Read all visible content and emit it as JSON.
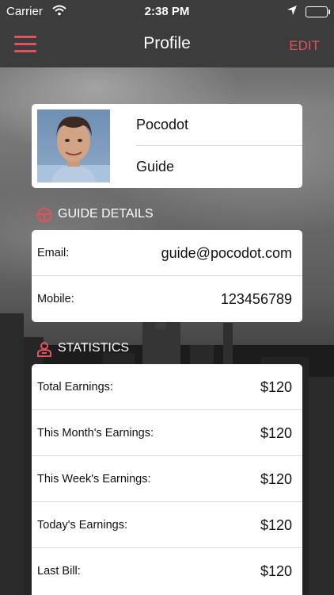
{
  "status_bar": {
    "carrier": "Carrier",
    "time": "2:38 PM",
    "battery_level": 1.0
  },
  "nav": {
    "title": "Profile",
    "edit_label": "EDIT"
  },
  "profile": {
    "name": "Pocodot",
    "role": "Guide"
  },
  "guide_details": {
    "title": "GUIDE DETAILS",
    "rows": [
      {
        "label": "Email:",
        "value": "guide@pocodot.com"
      },
      {
        "label": "Mobile:",
        "value": "123456789"
      }
    ]
  },
  "statistics": {
    "title": "STATISTICS",
    "rows": [
      {
        "label": "Total Earnings:",
        "value": "$120"
      },
      {
        "label": "This Month's Earnings:",
        "value": "$120"
      },
      {
        "label": "This Week's Earnings:",
        "value": "$120"
      },
      {
        "label": "Today's Earnings:",
        "value": "$120"
      },
      {
        "label": "Last Bill:",
        "value": "$120"
      }
    ]
  },
  "colors": {
    "accent": "#e2525c",
    "bar": "#3c3c3c"
  },
  "icons": {
    "menu": "hamburger-icon",
    "guide_details": "steering-wheel-icon",
    "statistics": "person-icon"
  }
}
